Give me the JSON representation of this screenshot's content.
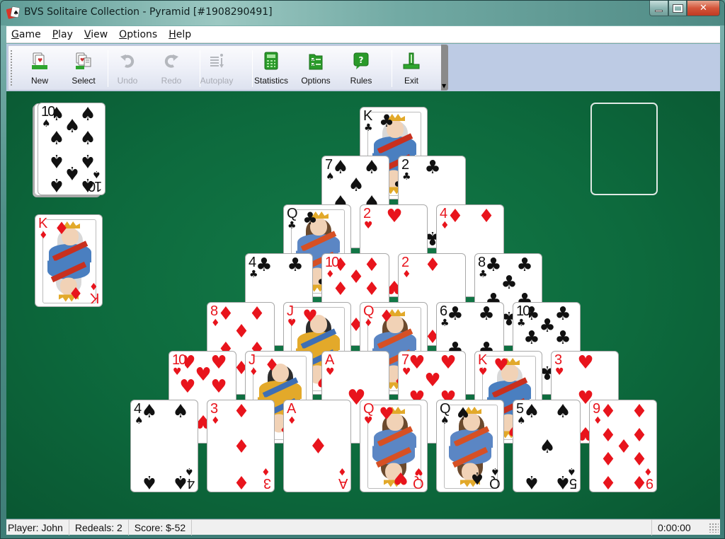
{
  "window": {
    "title": "BVS Solitaire Collection  -  Pyramid [#1908290491]",
    "controls": [
      "minimize",
      "maximize",
      "close"
    ]
  },
  "menu": [
    {
      "label": "Game",
      "accel": "G"
    },
    {
      "label": "Play",
      "accel": "P"
    },
    {
      "label": "View",
      "accel": "V"
    },
    {
      "label": "Options",
      "accel": "O"
    },
    {
      "label": "Help",
      "accel": "H"
    }
  ],
  "toolbar": {
    "buttons": [
      {
        "id": "new",
        "label": "New",
        "icon": "new-game-icon",
        "enabled": true
      },
      {
        "id": "select",
        "label": "Select",
        "icon": "select-game-icon",
        "enabled": true
      },
      {
        "id": "undo",
        "label": "Undo",
        "icon": "undo-icon",
        "enabled": false
      },
      {
        "id": "redo",
        "label": "Redo",
        "icon": "redo-icon",
        "enabled": false
      },
      {
        "id": "autoplay",
        "label": "Autoplay",
        "icon": "autoplay-icon",
        "enabled": false
      },
      {
        "id": "statistics",
        "label": "Statistics",
        "icon": "statistics-icon",
        "enabled": true
      },
      {
        "id": "options",
        "label": "Options",
        "icon": "options-icon",
        "enabled": true
      },
      {
        "id": "rules",
        "label": "Rules",
        "icon": "rules-icon",
        "enabled": true
      },
      {
        "id": "exit",
        "label": "Exit",
        "icon": "exit-icon",
        "enabled": true
      }
    ],
    "overflow_glyph": "▼"
  },
  "game": {
    "stock": {
      "rank": "10",
      "suit": "spades"
    },
    "waste": {
      "rank": "K",
      "suit": "diamonds"
    },
    "foundation": null,
    "pyramid": [
      [
        {
          "rank": "K",
          "suit": "clubs"
        }
      ],
      [
        {
          "rank": "7",
          "suit": "spades"
        },
        {
          "rank": "2",
          "suit": "clubs"
        }
      ],
      [
        {
          "rank": "Q",
          "suit": "clubs"
        },
        {
          "rank": "2",
          "suit": "hearts"
        },
        {
          "rank": "4",
          "suit": "diamonds"
        }
      ],
      [
        {
          "rank": "4",
          "suit": "clubs"
        },
        {
          "rank": "10",
          "suit": "diamonds"
        },
        {
          "rank": "2",
          "suit": "diamonds"
        },
        {
          "rank": "8",
          "suit": "clubs"
        }
      ],
      [
        {
          "rank": "8",
          "suit": "diamonds"
        },
        {
          "rank": "J",
          "suit": "hearts"
        },
        {
          "rank": "Q",
          "suit": "diamonds"
        },
        {
          "rank": "6",
          "suit": "clubs"
        },
        {
          "rank": "10",
          "suit": "clubs"
        }
      ],
      [
        {
          "rank": "10",
          "suit": "hearts"
        },
        {
          "rank": "J",
          "suit": "diamonds"
        },
        {
          "rank": "A",
          "suit": "hearts"
        },
        {
          "rank": "7",
          "suit": "hearts"
        },
        {
          "rank": "K",
          "suit": "hearts"
        },
        {
          "rank": "3",
          "suit": "hearts"
        }
      ],
      [
        {
          "rank": "4",
          "suit": "spades"
        },
        {
          "rank": "3",
          "suit": "diamonds"
        },
        {
          "rank": "A",
          "suit": "diamonds"
        },
        {
          "rank": "Q",
          "suit": "hearts"
        },
        {
          "rank": "Q",
          "suit": "spades"
        },
        {
          "rank": "5",
          "suit": "spades"
        },
        {
          "rank": "9",
          "suit": "diamonds"
        }
      ]
    ]
  },
  "suits": {
    "spades": {
      "glyph": "♠",
      "color": "#111111"
    },
    "clubs": {
      "glyph": "♣",
      "color": "#111111"
    },
    "hearts": {
      "glyph": "♥",
      "color": "#e8141c"
    },
    "diamonds": {
      "glyph": "♦",
      "color": "#e8141c"
    }
  },
  "statusbar": {
    "player": "Player: John",
    "redeals": "Redeals: 2",
    "score": "Score: $-52",
    "time": "0:00:00"
  },
  "colors": {
    "felt": "#0d6a3d",
    "toolbar_bg": "#bdcbe4"
  }
}
